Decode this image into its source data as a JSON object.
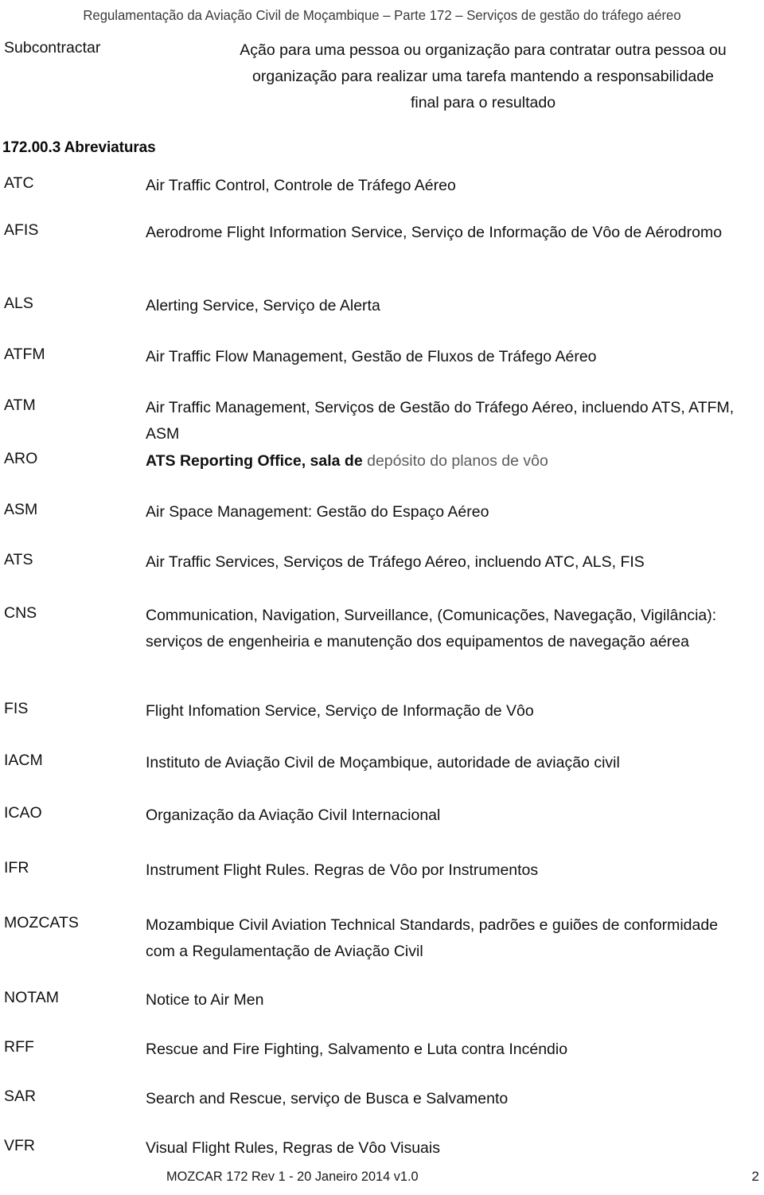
{
  "header": {
    "running_title": "Regulamentação da Aviação Civil de Moçambique – Parte 172 – Serviços de gestão do tráfego aéreo"
  },
  "intro_entry": {
    "term": "Subcontractar",
    "definition": "Ação para uma pessoa ou organização para contratar outra pessoa ou organização para realizar uma tarefa mantendo a responsabilidade final para o resultado"
  },
  "section": {
    "heading": "172.00.3 Abreviaturas"
  },
  "abbreviations": [
    {
      "term": "ATC",
      "definition": "Air  Traffic Control, Controle de Tráfego Aéreo"
    },
    {
      "term": "AFIS",
      "definition": "Aerodrome Flight Information Service, Serviço de Informação de Vôo de Aérodromo"
    },
    {
      "term": "ALS",
      "definition": "Alerting Service, Serviço de Alerta"
    },
    {
      "term": "ATFM",
      "definition": "Air Traffic Flow Management, Gestão de Fluxos de Tráfego Aéreo"
    },
    {
      "term": "ATM",
      "definition": "Air Traffic Management, Serviços de Gestão do Tráfego Aéreo, incluendo ATS, ATFM, ASM"
    },
    {
      "term": "ARO",
      "definition_strong": "ATS Reporting Office, sala de ",
      "definition_light": "depósito do planos de vôo"
    },
    {
      "term": "ASM",
      "definition": "Air Space Management: Gestão do Espaço Aéreo"
    },
    {
      "term": "ATS",
      "definition": "Air Traffic Services, Serviços de Tráfego Aéreo, incluendo ATC, ALS, FIS"
    },
    {
      "term": "CNS",
      "definition": "Communication, Navigation, Surveillance, (Comunicações, Navegação, Vigilância): serviços de engenheiria e manutenção dos equipamentos de navegação aérea"
    },
    {
      "term": "FIS",
      "definition": "Flight Infomation Service, Serviço de Informação de Vôo"
    },
    {
      "term": "IACM",
      "definition": "Instituto de Aviação Civil de Moçambique, autoridade de aviação civil"
    },
    {
      "term": "ICAO",
      "definition": "Organização da Aviação Civil Internacional"
    },
    {
      "term": "IFR",
      "definition": "Instrument Flight Rules. Regras de Vôo por Instrumentos"
    },
    {
      "term": "MOZCATS",
      "definition": "Mozambique Civil Aviation Technical Standards, padrões e guiões de conformidade com a Regulamentação de Aviação Civil"
    },
    {
      "term": "NOTAM",
      "definition": "Notice to Air Men"
    },
    {
      "term": "RFF",
      "definition": "Rescue and Fire Fighting, Salvamento e Luta contra Incéndio"
    },
    {
      "term": "SAR",
      "definition": "Search and Rescue, serviço de Busca e Salvamento"
    },
    {
      "term": "VFR",
      "definition": "Visual Flight Rules, Regras de Vôo Visuais"
    }
  ],
  "footer": {
    "text": "MOZCAR  172 Rev 1 - 20  Janeiro 2014    v1.0",
    "page_number": "2"
  }
}
